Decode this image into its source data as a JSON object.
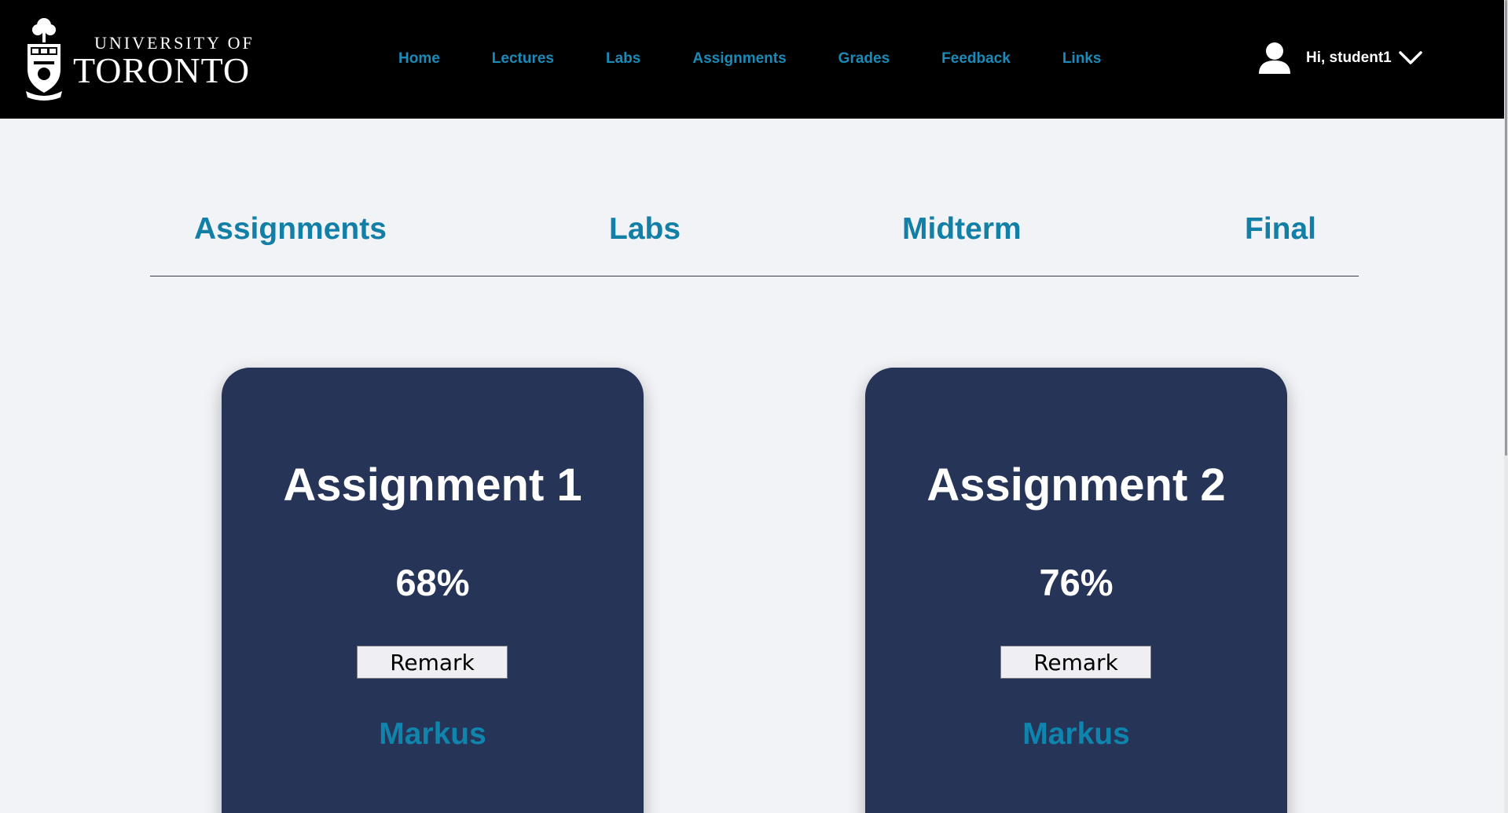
{
  "logo": {
    "line1": "UNIVERSITY OF",
    "line2": "TORONTO"
  },
  "nav": {
    "links": [
      "Home",
      "Lectures",
      "Labs",
      "Assignments",
      "Grades",
      "Feedback",
      "Links"
    ]
  },
  "user": {
    "greeting": "Hi, student1",
    "icon": "user-icon",
    "menu_icon": "chevron-down-icon"
  },
  "section_tabs": [
    "Assignments",
    "Labs",
    "Midterm",
    "Final"
  ],
  "cards": [
    {
      "title": "Assignment 1",
      "score": "68%",
      "button_label": "Remark",
      "link_text": "Markus"
    },
    {
      "title": "Assignment 2",
      "score": "76%",
      "button_label": "Remark",
      "link_text": "Markus"
    }
  ],
  "colors": {
    "navbar_bg": "#000000",
    "nav_link": "#1a8bb8",
    "page_bg": "#f2f3f6",
    "card_bg": "#263458",
    "accent": "#127fa6"
  }
}
